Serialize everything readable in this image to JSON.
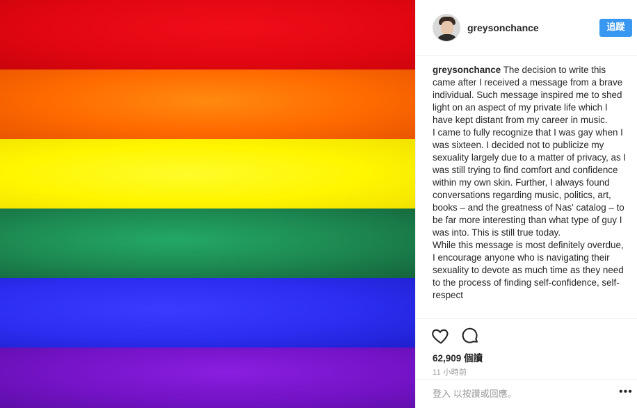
{
  "post": {
    "image_alt": "Rainbow flag",
    "stripe_colors": [
      "#e10610",
      "#ff6a00",
      "#fff600",
      "#1d8a52",
      "#2c2df0",
      "#7413c7"
    ]
  },
  "header": {
    "username": "greysonchance",
    "follow_label": "追蹤"
  },
  "caption": {
    "username": "greysonchance",
    "paragraphs": [
      "The decision to write this came after I received a message from a brave individual. Such message inspired me to shed light on an aspect of my private life which I have kept distant from my career in music.",
      "I came to fully recognize that I was gay when I was sixteen. I decided not to publicize my sexuality largely due to a matter of privacy, as I was still trying to find comfort and confidence within my own skin. Further, I always found conversations regarding music, politics, art, books – and the greatness of Nas' catalog – to be far more interesting than what type of guy I was into. This is still true today.",
      "While this message is most definitely overdue, I encourage anyone who is navigating their sexuality to devote as much time as they need to the process of finding self-confidence, self-respect"
    ]
  },
  "actions": {
    "like_icon": "heart-icon",
    "comment_icon": "comment-icon",
    "views": "62,909 個讀",
    "timestamp": "11 小時前"
  },
  "footer": {
    "login_prompt": "登入 以按讚或回應。",
    "more": "•••"
  }
}
